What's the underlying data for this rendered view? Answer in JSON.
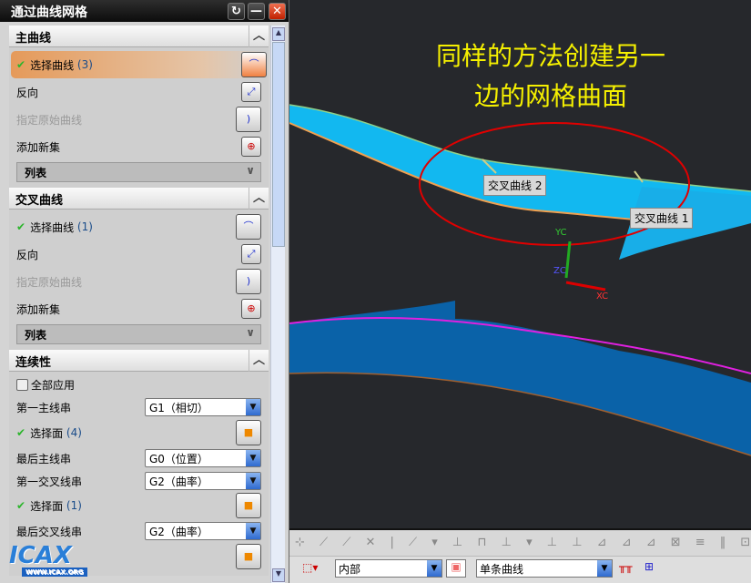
{
  "annotation": {
    "line1": "同样的方法创建另一",
    "line2": "边的网格曲面"
  },
  "viewport": {
    "tag1": "交叉曲线 2",
    "tag2": "交叉曲线 1",
    "axis_y": "YC",
    "axis_z": "ZC",
    "axis_x": "XC"
  },
  "dialog": {
    "title": "通过曲线网格",
    "primary": {
      "header": "主曲线",
      "select": "选择曲线",
      "count": "(3)",
      "reverse": "反向",
      "origin": "指定原始曲线",
      "add": "添加新集",
      "list": "列表"
    },
    "cross": {
      "header": "交叉曲线",
      "select": "选择曲线",
      "count": "(1)",
      "reverse": "反向",
      "origin": "指定原始曲线",
      "add": "添加新集",
      "list": "列表"
    },
    "continuity": {
      "header": "连续性",
      "apply_all": "全部应用",
      "first_primary": "第一主线串",
      "first_primary_val": "G1（相切）",
      "face1": "选择面",
      "face1_count": "(4)",
      "last_primary": "最后主线串",
      "last_primary_val": "G0（位置）",
      "first_cross": "第一交叉线串",
      "first_cross_val": "G2（曲率）",
      "face2": "选择面",
      "face2_count": "(1)",
      "last_cross": "最后交叉线串",
      "last_cross_val": "G2（曲率）"
    }
  },
  "toolbar": {
    "filter": "内部",
    "curve_rule": "单条曲线"
  },
  "logo": {
    "text": "ICAX",
    "url": "WWW.ICAX.ORG"
  },
  "colors": {
    "surface": "#10b8f0",
    "accent": "#e59a5a",
    "annot": "#f5f000"
  }
}
